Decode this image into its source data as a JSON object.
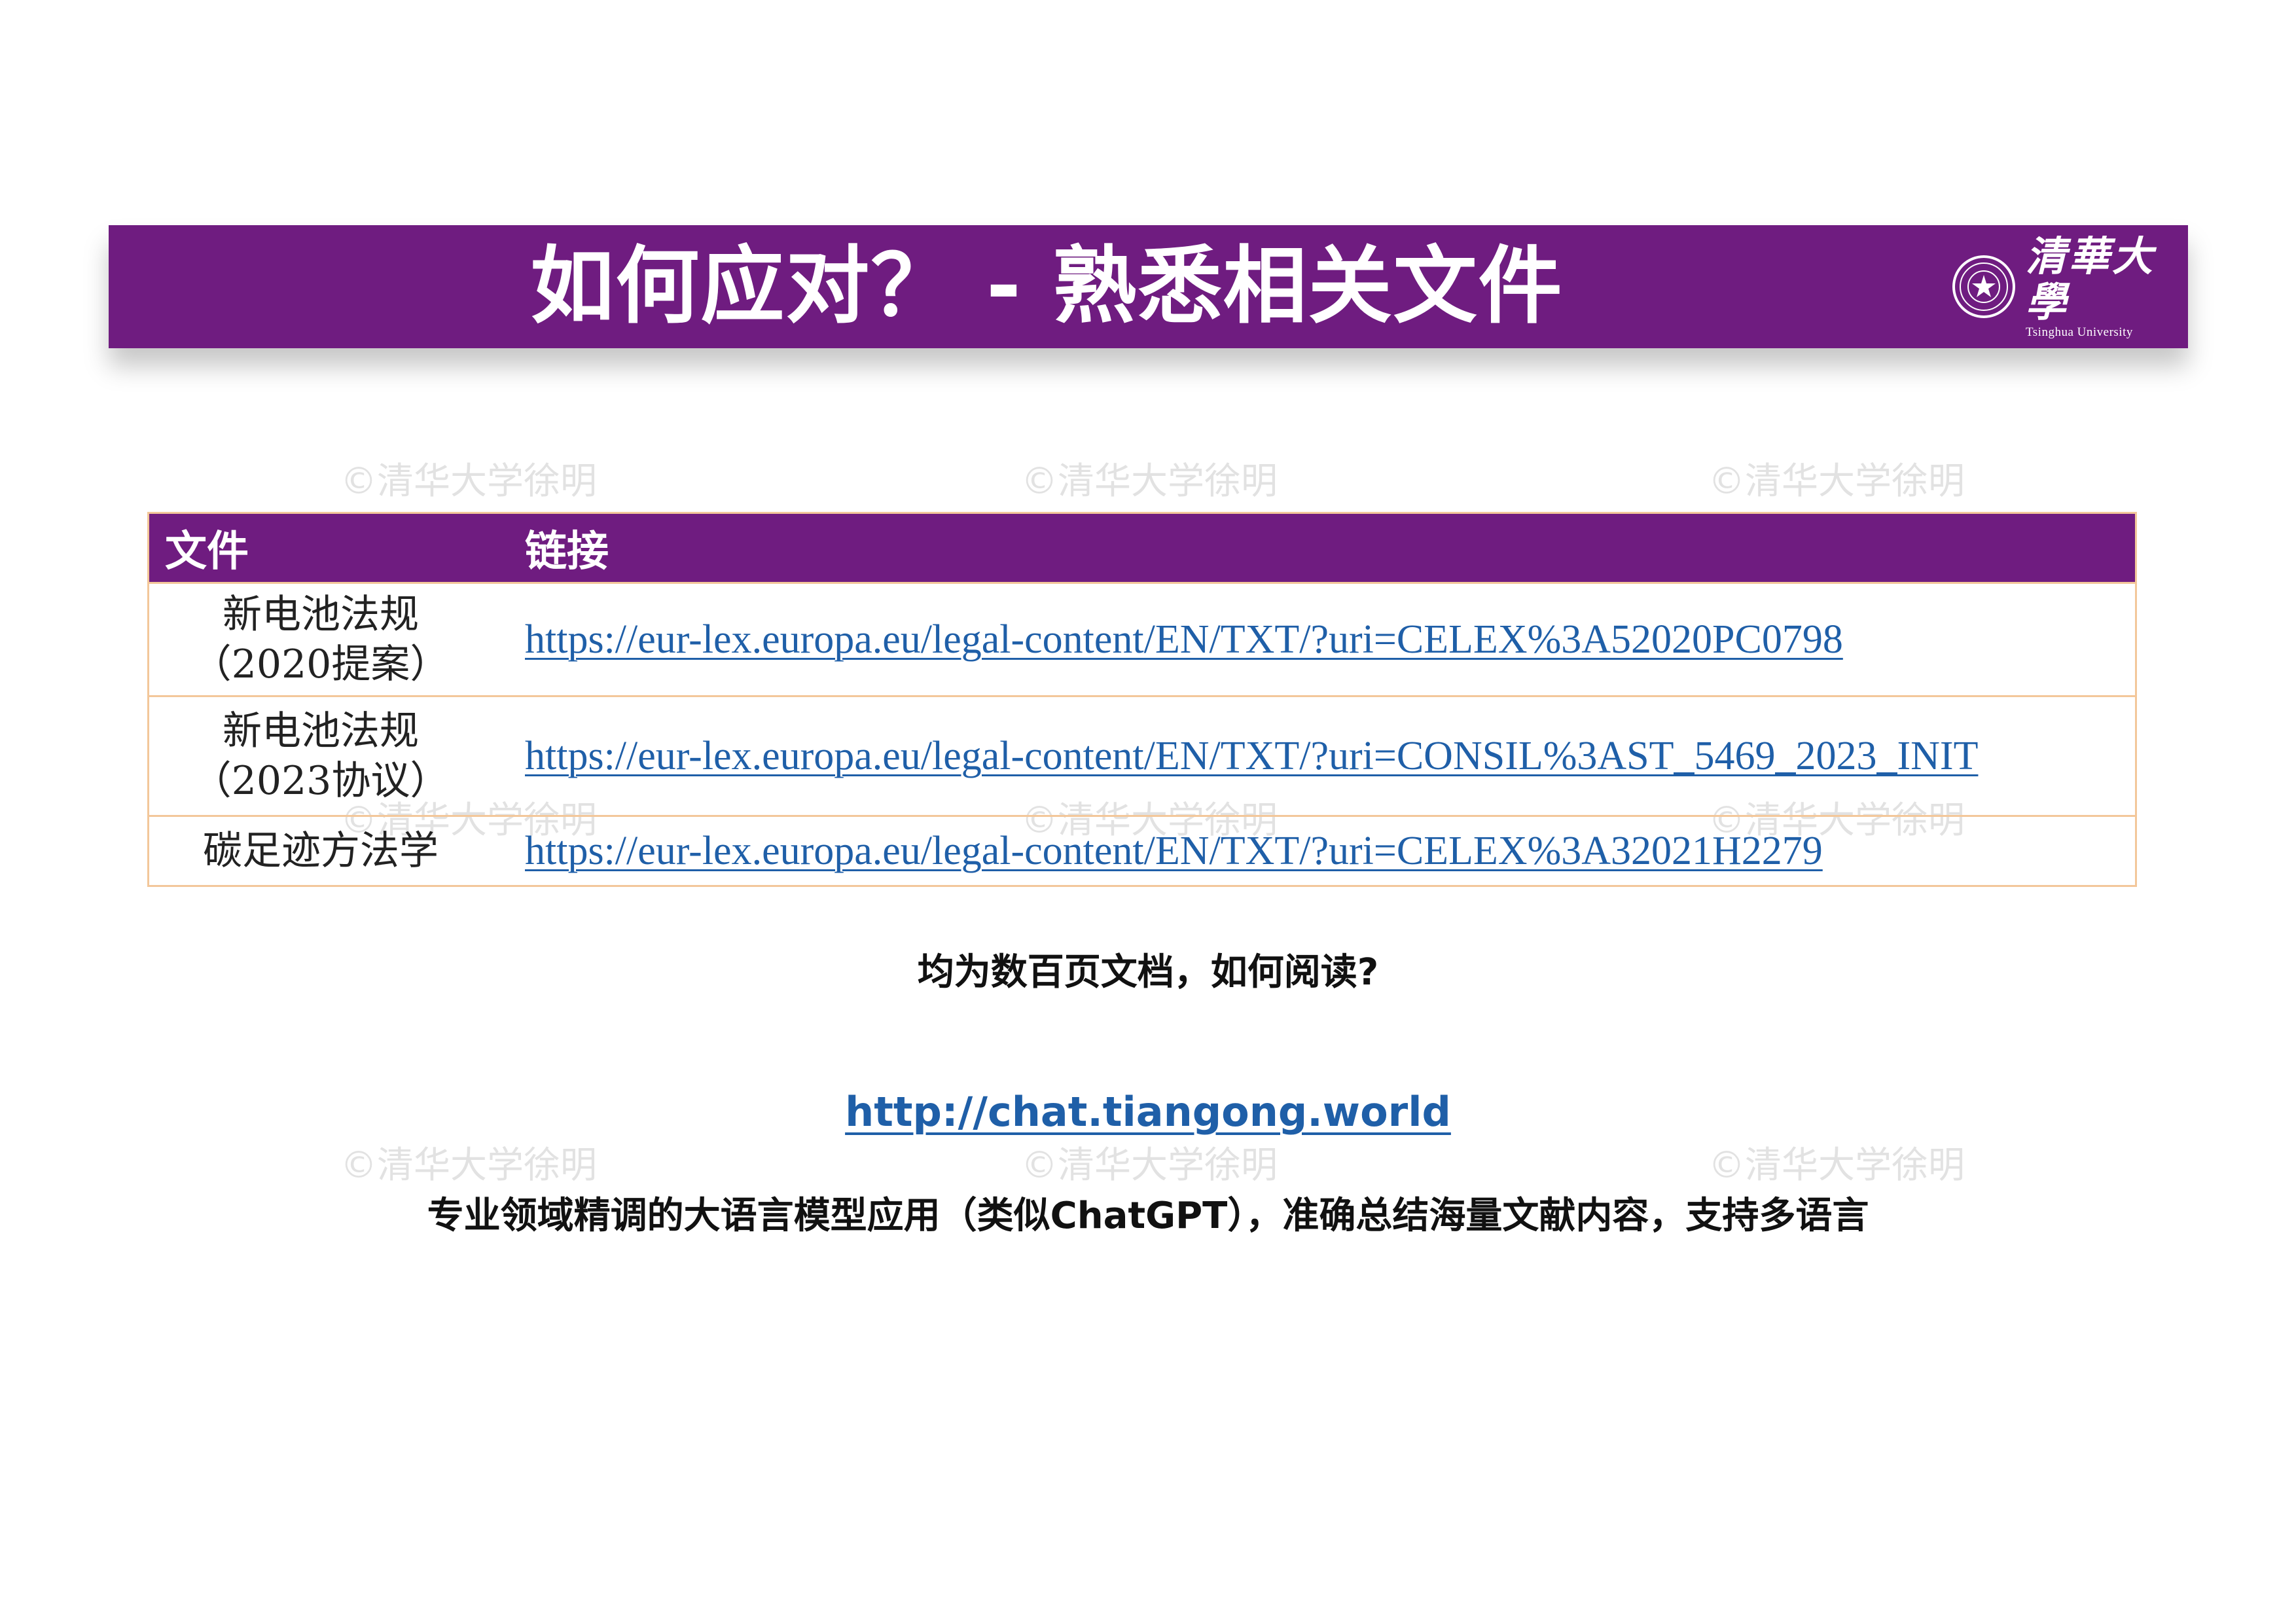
{
  "header": {
    "title": "如何应对？ - 熟悉相关文件",
    "logo_cn": "清華大學",
    "logo_en": "Tsinghua University"
  },
  "watermark": "©清华大学徐明",
  "table": {
    "headers": [
      "文件",
      "链接"
    ],
    "rows": [
      {
        "name_lines": [
          "新电池法规",
          "（2020提案）"
        ],
        "url": "https://eur-lex.europa.eu/legal-content/EN/TXT/?uri=CELEX%3A52020PC0798"
      },
      {
        "name_lines": [
          "新电池法规",
          "（2023协议）"
        ],
        "url": "https://eur-lex.europa.eu/legal-content/EN/TXT/?uri=CONSIL%3AST_5469_2023_INIT"
      },
      {
        "name_lines": [
          "碳足迹方法学"
        ],
        "url": "https://eur-lex.europa.eu/legal-content/EN/TXT/?uri=CELEX%3A32021H2279"
      }
    ]
  },
  "question": "均为数百页文档，如何阅读?",
  "site_link": "http://chat.tiangong.world",
  "description": "专业领域精调的大语言模型应用（类似ChatGPT），准确总结海量文献内容，支持多语言",
  "colors": {
    "banner": "#6f1c80",
    "table_border": "#f3c79a",
    "link": "#1f5fa8"
  }
}
